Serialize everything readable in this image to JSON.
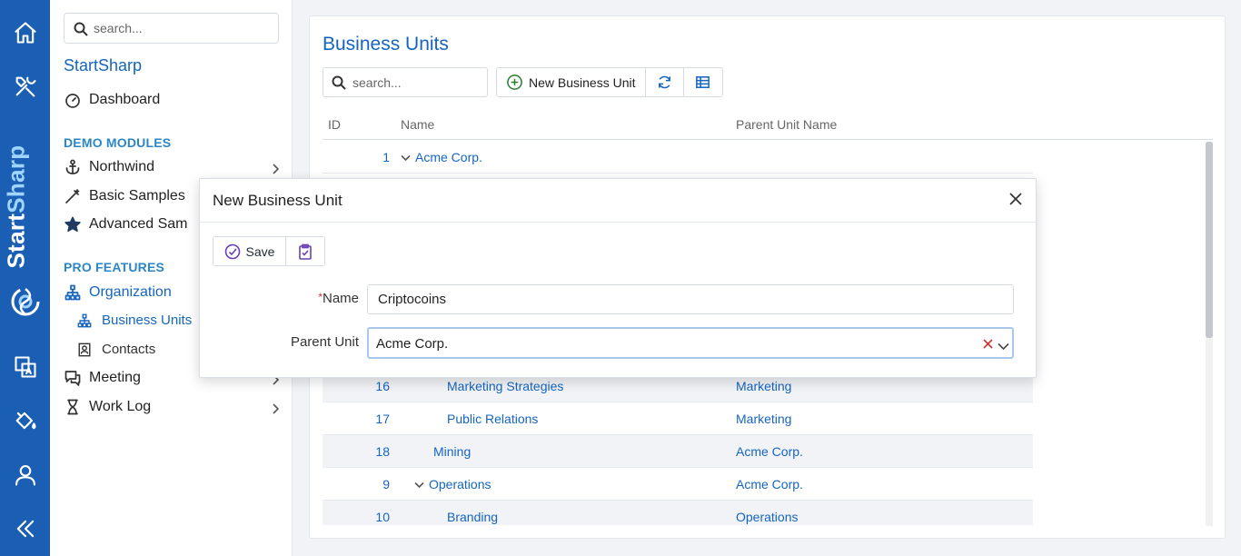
{
  "colors": {
    "rail_bg": "#1b5fb4",
    "accent": "#1565c0",
    "section": "#2b86c7",
    "required": "#d32f2f",
    "save_icon": "#6a3fb5"
  },
  "rail": {
    "brand_part1": "Start",
    "brand_part2": "Sharp",
    "icons": [
      "home-icon",
      "tools-icon",
      "translate-icon",
      "paint-bucket-icon",
      "user-icon",
      "collapse-icon"
    ]
  },
  "sidebar": {
    "search_placeholder": "search...",
    "app_title": "StartSharp",
    "dashboard": "Dashboard",
    "demo_header": "DEMO MODULES",
    "northwind": "Northwind",
    "basic_samples": "Basic Samples",
    "advanced_samples": "Advanced Sam",
    "pro_header": "PRO FEATURES",
    "organization": "Organization",
    "business_units": "Business Units",
    "contacts": "Contacts",
    "meeting": "Meeting",
    "work_log": "Work Log"
  },
  "main": {
    "title": "Business Units",
    "search_placeholder": "search...",
    "new_button": "New Business Unit",
    "columns": {
      "id": "ID",
      "name": "Name",
      "parent": "Parent Unit Name"
    },
    "rows": [
      {
        "id": "1",
        "name": "Acme Corp.",
        "parent": "",
        "expanded": true
      },
      {
        "id": "16",
        "name": "Marketing Strategies",
        "parent": "Marketing"
      },
      {
        "id": "17",
        "name": "Public Relations",
        "parent": "Marketing"
      },
      {
        "id": "18",
        "name": "Mining",
        "parent": "Acme Corp."
      },
      {
        "id": "9",
        "name": "Operations",
        "parent": "Acme Corp.",
        "expanded": true
      },
      {
        "id": "10",
        "name": "Branding",
        "parent": "Operations"
      }
    ]
  },
  "dialog": {
    "title": "New Business Unit",
    "save": "Save",
    "name_label": "Name",
    "required_mark": "*",
    "name_value": "Criptocoins",
    "parent_label": "Parent Unit",
    "parent_value": "Acme Corp."
  }
}
